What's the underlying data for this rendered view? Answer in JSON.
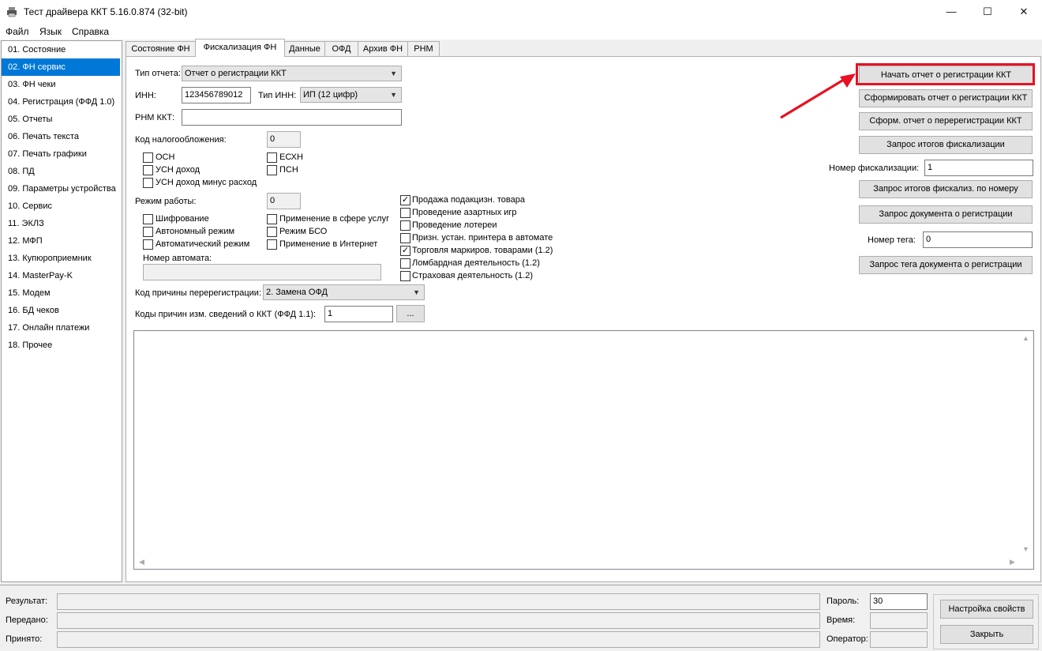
{
  "window": {
    "title": "Тест драйвера ККТ 5.16.0.874 (32-bit)",
    "min_glyph": "—",
    "max_glyph": "☐",
    "close_glyph": "✕"
  },
  "menu": [
    "Файл",
    "Язык",
    "Справка"
  ],
  "nav": {
    "items": [
      "01. Состояние",
      "02. ФН сервис",
      "03. ФН чеки",
      "04. Регистрация (ФФД 1.0)",
      "05. Отчеты",
      "06. Печать текста",
      "07. Печать графики",
      "08. ПД",
      "09. Параметры устройства",
      "10. Сервис",
      "11. ЭКЛЗ",
      "12. МФП",
      "13. Купюроприемник",
      "14. MasterPay-K",
      "15. Модем",
      "16. БД чеков",
      "17. Онлайн платежи",
      "18. Прочее"
    ],
    "selected": "02. ФН сервис"
  },
  "tabs": [
    "Состояние ФН",
    "Фискализация ФН",
    "Данные",
    "ОФД",
    "Архив ФН",
    "РНМ"
  ],
  "active_tab": "Фискализация ФН",
  "form": {
    "report_type_label": "Тип отчета:",
    "report_type_value": "Отчет о регистрации ККТ",
    "inn_label": "ИНН:",
    "inn_value": "123456789012",
    "inn_type_label": "Тип ИНН:",
    "inn_type_value": "ИП (12 цифр)",
    "rnm_label": "РНМ ККТ:",
    "rnm_value": "",
    "tax_label": "Код налогообложения:",
    "tax_value": "0",
    "tax_options": [
      {
        "label": "ОСН",
        "checked": false
      },
      {
        "label": "УСН доход",
        "checked": false
      },
      {
        "label": "УСН доход минус расход",
        "checked": false
      },
      {
        "label": "ЕСХН",
        "checked": false
      },
      {
        "label": "ПСН",
        "checked": false
      }
    ],
    "mode_label": "Режим работы:",
    "mode_value": "0",
    "mode_options": [
      {
        "label": "Шифрование",
        "checked": false
      },
      {
        "label": "Автономный режим",
        "checked": false
      },
      {
        "label": "Автоматический режим",
        "checked": false
      },
      {
        "label": "Применение в сфере услуг",
        "checked": false
      },
      {
        "label": "Режим БСО",
        "checked": false
      },
      {
        "label": "Применение в Интернет",
        "checked": false
      }
    ],
    "automat_label": "Номер автомата:",
    "automat_value": "",
    "extra_options": [
      {
        "label": "Продажа подакцизн. товара",
        "checked": true
      },
      {
        "label": "Проведение азартных игр",
        "checked": false
      },
      {
        "label": "Проведение лотереи",
        "checked": false
      },
      {
        "label": "Призн. устан. принтера в автомате",
        "checked": false
      },
      {
        "label": "Торговля маркиров. товарами (1.2)",
        "checked": true
      },
      {
        "label": "Ломбардная деятельность (1.2)",
        "checked": false
      },
      {
        "label": "Страховая деятельность (1.2)",
        "checked": false
      }
    ],
    "rereg_label": "Код причины перерегистрации:",
    "rereg_value": "2. Замена ОФД",
    "change_codes_label": "Коды причин изм. сведений о ККТ (ФФД 1.1):",
    "change_codes_value": "1",
    "ellipsis": "...",
    "check_mark": "✓",
    "dropdown_glyph": "▼"
  },
  "actions": {
    "start_report": "Начать отчет о регистрации ККТ",
    "make_report": "Сформировать отчет о регистрации ККТ",
    "make_rereg": "Сформ. отчет о перерегистрации ККТ",
    "query_fisc": "Запрос итогов фискализации",
    "fisc_num_label": "Номер фискализации:",
    "fisc_num_value": "1",
    "query_fisc_by_num": "Запрос итогов фискализ. по номеру",
    "query_reg_doc": "Запрос документа о регистрации",
    "tag_num_label": "Номер тега:",
    "tag_num_value": "0",
    "query_reg_tag": "Запрос тега документа о регистрации"
  },
  "status": {
    "result_label": "Результат:",
    "sent_label": "Передано:",
    "received_label": "Принято:",
    "password_label": "Пароль:",
    "password_value": "30",
    "time_label": "Время:",
    "operator_label": "Оператор:",
    "settings_button": "Настройка свойств",
    "close_button": "Закрыть"
  },
  "colors": {
    "selection": "#0078d7",
    "highlight": "#e81123",
    "window_bg": "#f0f0f0"
  }
}
